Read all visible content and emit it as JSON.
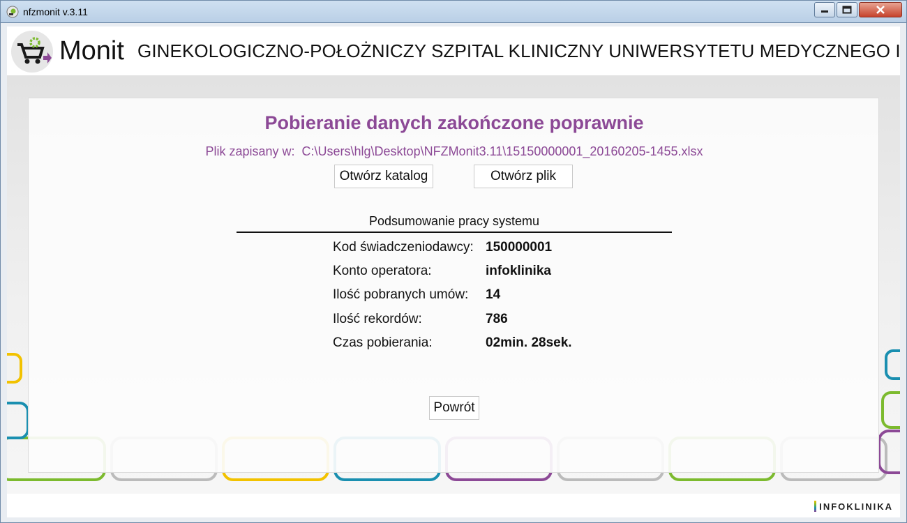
{
  "window": {
    "title": "nfzmonit v.3.11"
  },
  "header": {
    "brand": "Monit",
    "hospital_name": "GINEKOLOGICZNO-POŁOŻNICZY SZPITAL KLINICZNY UNIWERSYTETU MEDYCZNEGO IM.",
    "logo_icon": "cart-gear-icon"
  },
  "status": {
    "headline": "Pobieranie danych zakończone poprawnie",
    "file_label": "Plik zapisany w:",
    "file_path": "C:\\Users\\hlg\\Desktop\\NFZMonit3.11\\15150000001_20160205-1455.xlsx"
  },
  "actions": {
    "open_directory": "Otwórz katalog",
    "open_file": "Otwórz plik",
    "back": "Powrót"
  },
  "summary": {
    "title": "Podsumowanie pracy systemu",
    "rows": [
      {
        "label": "Kod świadczeniodawcy:",
        "value": "150000001"
      },
      {
        "label": "Konto operatora:",
        "value": "infoklinika"
      },
      {
        "label": "Ilość pobranych umów:",
        "value": "14"
      },
      {
        "label": "Ilość rekordów:",
        "value": "786"
      },
      {
        "label": "Czas pobierania:",
        "value": "02min. 28sek."
      }
    ]
  },
  "footer": {
    "vendor": "INFOKLINIKA"
  },
  "colors": {
    "accent": "#8c4996",
    "titlebar": "#c3d6eb",
    "close_button": "#c6432c"
  }
}
